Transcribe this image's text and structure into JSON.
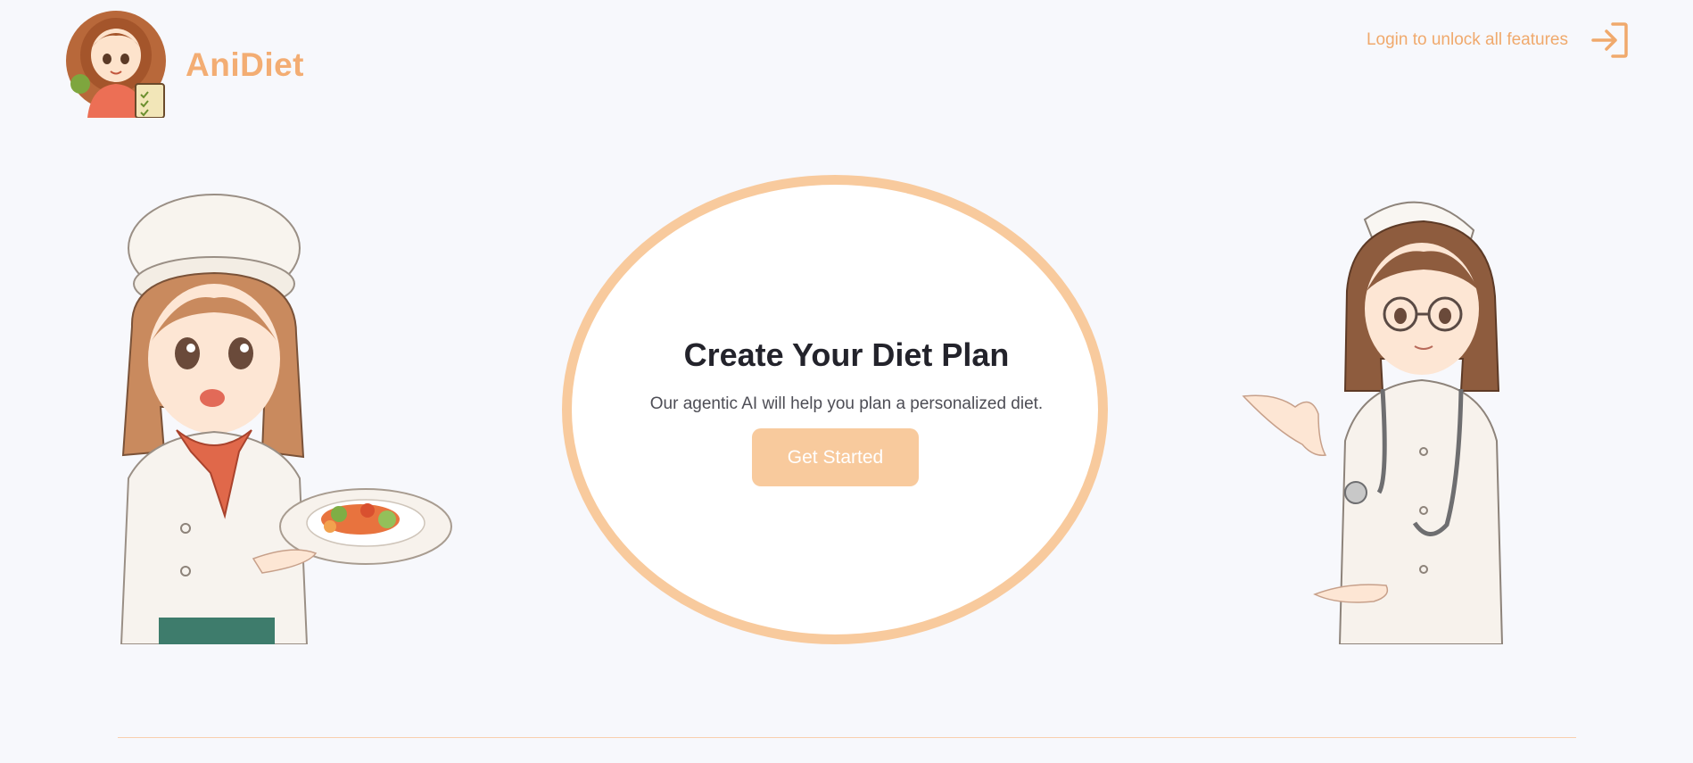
{
  "header": {
    "brand": "AniDiet",
    "login_text": "Login to unlock all features"
  },
  "hero": {
    "title": "Create Your Diet Plan",
    "subtitle": "Our agentic AI will help you plan a personalized diet.",
    "button_label": "Get Started"
  },
  "colors": {
    "accent": "#f3ad73",
    "button": "#f8ca9d",
    "background": "#f7f8fc"
  },
  "icons": {
    "login": "login-arrow-icon"
  }
}
